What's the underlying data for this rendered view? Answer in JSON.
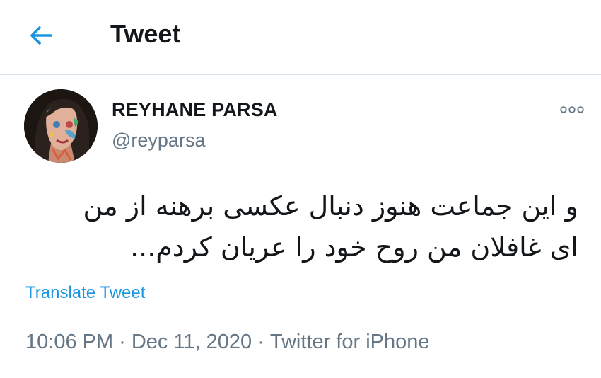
{
  "header": {
    "title": "Tweet",
    "back_icon": "back-arrow-icon"
  },
  "tweet": {
    "author": {
      "name": "REYHANE PARSA",
      "handle": "@reyparsa"
    },
    "more_icon": "more-options-icon",
    "text_lines": [
      "و این جماعت هنوز دنبال عکسی برهنه از من",
      "ای غافلان من روح خود را عریان کردم..."
    ],
    "translate_label": "Translate Tweet",
    "time": "10:06 PM",
    "separator": "·",
    "date": "Dec 11, 2020",
    "source": "Twitter for iPhone"
  },
  "colors": {
    "accent": "#1b95e0",
    "muted": "#657786",
    "text": "#14171a",
    "divider": "#d6e2ec"
  }
}
